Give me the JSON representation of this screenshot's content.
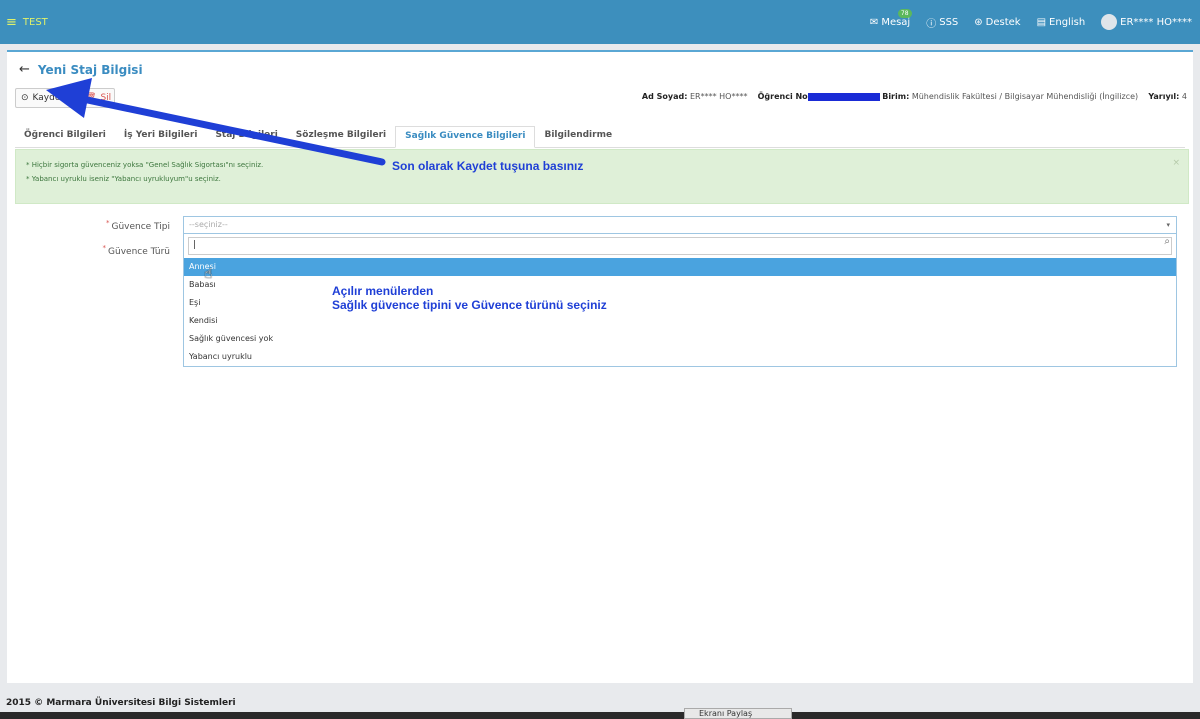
{
  "topbar": {
    "app_name": "TEST",
    "items": [
      {
        "label": "Mesaj",
        "icon": "envelope-icon",
        "badge": "78"
      },
      {
        "label": "SSS",
        "icon": "question-icon"
      },
      {
        "label": "Destek",
        "icon": "support-icon"
      },
      {
        "label": "English",
        "icon": "language-icon"
      }
    ],
    "user_name": "ER**** HO****"
  },
  "page": {
    "title": "Yeni Staj Bilgisi"
  },
  "toolbar": {
    "save_label": "Kaydet",
    "delete_label": "Sil"
  },
  "student_info": {
    "name_label": "Ad Soyad:",
    "name_value": "ER**** HO****",
    "no_label": "Öğrenci No",
    "unit_label": "Birim:",
    "unit_value": "Mühendislik Fakültesi / Bilgisayar Mühendisliği (İngilizce)",
    "semester_label": "Yarıyıl:",
    "semester_value": "4"
  },
  "tabs": [
    {
      "label": "Öğrenci Bilgileri"
    },
    {
      "label": "İş Yeri Bilgileri"
    },
    {
      "label": "Staj Bilgileri"
    },
    {
      "label": "Sözleşme Bilgileri"
    },
    {
      "label": "Sağlık Güvence Bilgileri",
      "active": true
    },
    {
      "label": "Bilgilendirme"
    }
  ],
  "alert": {
    "lines": [
      "* Hiçbir sigorta güvenceniz yoksa \"Genel Sağlık Sigortası\"nı seçiniz.",
      "* Yabancı uyruklu iseniz \"Yabancı uyrukluyum\"u seçiniz."
    ],
    "close": "×"
  },
  "form": {
    "tip_label": "Güvence Tipi",
    "tur_label": "Güvence Türü",
    "tip_placeholder": "--seçiniz--",
    "options": [
      "Annesi",
      "Babası",
      "Eşi",
      "Kendisi",
      "Sağlık güvencesi yok",
      "Yabancı uyruklu"
    ]
  },
  "annotations": {
    "top": "Son olarak Kaydet tuşuna basınız",
    "mid_line1": "Açılır menülerden",
    "mid_line2": "Sağlık güvence tipini ve Güvence türünü seçiniz"
  },
  "colors": {
    "topbar": "#3d8fbd",
    "accent": "#3a8cc1",
    "annotation": "#1f3fd6",
    "highlight": "#4aa3df"
  },
  "footer": {
    "text": "2015 © Marmara Üniversitesi Bilgi Sistemleri"
  },
  "taskbar": {
    "tab_label": "Ekranı Paylaş"
  }
}
